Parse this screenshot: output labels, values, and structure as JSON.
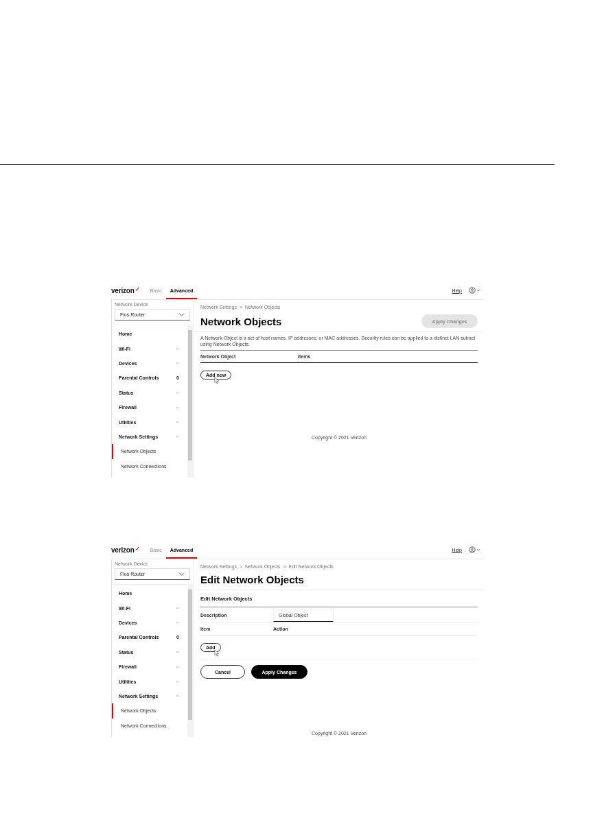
{
  "screens": [
    {
      "header": {
        "logo": "verizon",
        "tabs": [
          {
            "label": "Basic",
            "selected": false
          },
          {
            "label": "Advanced",
            "selected": true
          }
        ],
        "help": "Help"
      },
      "sidebar": {
        "device_label": "Network Device",
        "device": "Fios Router",
        "items": [
          {
            "label": "Home",
            "kind": "plain",
            "selected": false
          },
          {
            "label": "Wi-Fi",
            "kind": "expandable",
            "expanded": false,
            "selected": false
          },
          {
            "label": "Devices",
            "kind": "expandable",
            "expanded": false,
            "selected": false
          },
          {
            "label": "Parental Controls",
            "kind": "count",
            "count": "0",
            "selected": false
          },
          {
            "label": "Status",
            "kind": "expandable",
            "expanded": false,
            "selected": false
          },
          {
            "label": "Firewall",
            "kind": "expandable",
            "expanded": false,
            "selected": false
          },
          {
            "label": "Utilities",
            "kind": "expandable",
            "expanded": false,
            "selected": false
          },
          {
            "label": "Network Settings",
            "kind": "expandable",
            "expanded": true,
            "selected": false
          },
          {
            "label": "Network Objects",
            "kind": "sub",
            "selected": true
          },
          {
            "label": "Network Connections",
            "kind": "sub",
            "selected": false
          }
        ]
      },
      "main": {
        "breadcrumbs": [
          "Network Settings",
          "Network Objects"
        ],
        "breadcrumb_separator": ">",
        "title": "Network Objects",
        "header_button": {
          "label": "Apply Changes",
          "disabled": true
        },
        "description": "A Network Object is a set of host names, IP addresses, or MAC addresses. Security rules can be applied to a distinct LAN subnet using Network Objects.",
        "columns": [
          "Network Object",
          "Items"
        ],
        "add_button": "Add new",
        "copyright": "Copyright © 2021 Verizon"
      }
    },
    {
      "header": {
        "logo": "verizon",
        "tabs": [
          {
            "label": "Basic",
            "selected": false
          },
          {
            "label": "Advanced",
            "selected": true
          }
        ],
        "help": "Help"
      },
      "sidebar": {
        "device_label": "Network Device",
        "device": "Fios Router",
        "items": [
          {
            "label": "Home",
            "kind": "plain",
            "selected": false
          },
          {
            "label": "Wi-Fi",
            "kind": "expandable",
            "expanded": false,
            "selected": false
          },
          {
            "label": "Devices",
            "kind": "expandable",
            "expanded": false,
            "selected": false
          },
          {
            "label": "Parental Controls",
            "kind": "count",
            "count": "0",
            "selected": false
          },
          {
            "label": "Status",
            "kind": "expandable",
            "expanded": false,
            "selected": false
          },
          {
            "label": "Firewall",
            "kind": "expandable",
            "expanded": false,
            "selected": false
          },
          {
            "label": "Utilities",
            "kind": "expandable",
            "expanded": false,
            "selected": false
          },
          {
            "label": "Network Settings",
            "kind": "expandable",
            "expanded": true,
            "selected": false
          },
          {
            "label": "Network Objects",
            "kind": "sub",
            "selected": true
          },
          {
            "label": "Network Connections",
            "kind": "sub",
            "selected": false
          }
        ]
      },
      "main": {
        "breadcrumbs": [
          "Network Settings",
          "Network Objects",
          "Edit Network Objects"
        ],
        "breadcrumb_separator": ">",
        "title": "Edit Network Objects",
        "section_title": "Edit Network Objects",
        "fields": [
          {
            "label": "Description",
            "value": "Global Object"
          }
        ],
        "columns": [
          "Item",
          "Action"
        ],
        "add_button": "Add",
        "buttons": [
          {
            "label": "Cancel",
            "kind": "secondary"
          },
          {
            "label": "Apply Changes",
            "kind": "primary"
          }
        ],
        "copyright": "Copyright © 2021 Verizon"
      }
    }
  ]
}
